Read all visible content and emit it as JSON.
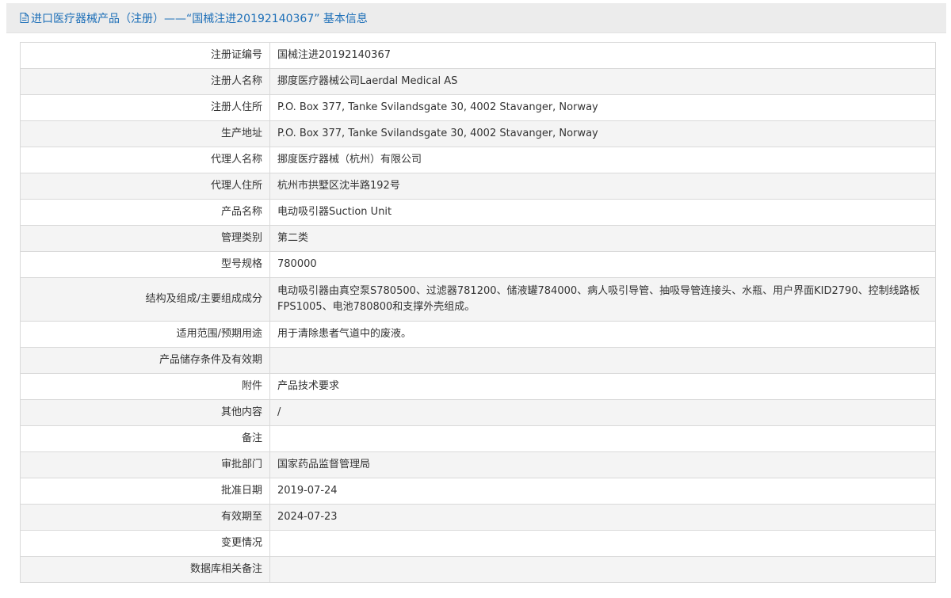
{
  "header": {
    "title": "进口医疗器械产品（注册）——“国械注进20192140367” 基本信息",
    "icon": "document-icon",
    "color": "#1d6fb8"
  },
  "rows": [
    {
      "label": "注册证编号",
      "value": "国械注进20192140367"
    },
    {
      "label": "注册人名称",
      "value": "挪度医疗器械公司Laerdal Medical AS"
    },
    {
      "label": "注册人住所",
      "value": "P.O. Box 377, Tanke Svilandsgate 30, 4002 Stavanger, Norway"
    },
    {
      "label": "生产地址",
      "value": "P.O. Box 377, Tanke Svilandsgate 30, 4002 Stavanger, Norway"
    },
    {
      "label": "代理人名称",
      "value": "挪度医疗器械（杭州）有限公司"
    },
    {
      "label": "代理人住所",
      "value": "杭州市拱墅区沈半路192号"
    },
    {
      "label": "产品名称",
      "value": "电动吸引器Suction Unit"
    },
    {
      "label": "管理类别",
      "value": "第二类"
    },
    {
      "label": "型号规格",
      "value": "780000"
    },
    {
      "label": "结构及组成/主要组成成分",
      "value": "电动吸引器由真空泵S780500、过滤器781200、储液罐784000、病人吸引导管、抽吸导管连接头、水瓶、用户界面KID2790、控制线路板FPS1005、电池780800和支撑外壳组成。"
    },
    {
      "label": "适用范围/预期用途",
      "value": "用于清除患者气道中的废液。"
    },
    {
      "label": "产品储存条件及有效期",
      "value": ""
    },
    {
      "label": "附件",
      "value": "产品技术要求"
    },
    {
      "label": "其他内容",
      "value": "/"
    },
    {
      "label": "备注",
      "value": ""
    },
    {
      "label": "审批部门",
      "value": "国家药品监督管理局"
    },
    {
      "label": "批准日期",
      "value": "2019-07-24"
    },
    {
      "label": "有效期至",
      "value": "2024-07-23"
    },
    {
      "label": "变更情况",
      "value": ""
    },
    {
      "label": "数据库相关备注",
      "value": ""
    }
  ]
}
